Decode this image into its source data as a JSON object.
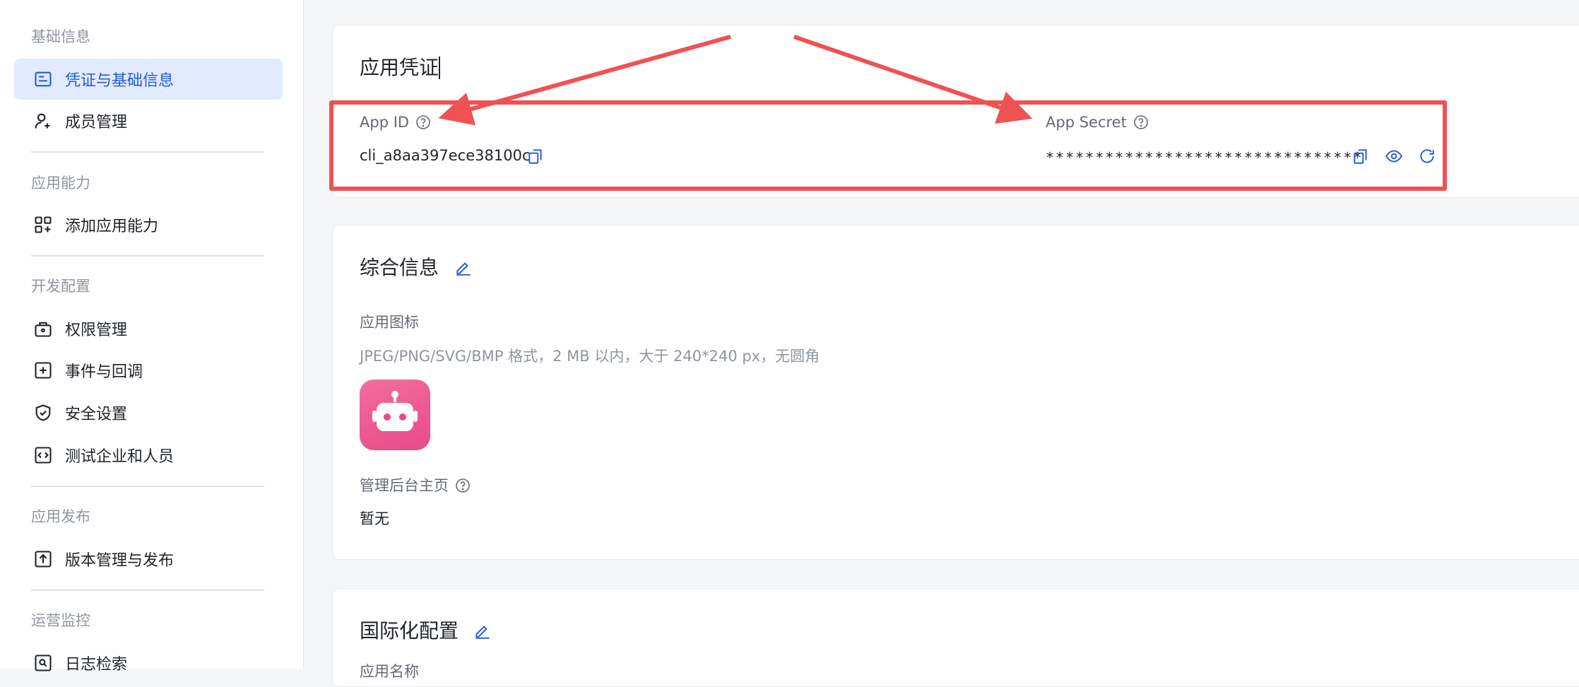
{
  "sidebar": {
    "sections": [
      {
        "title": "基础信息",
        "items": [
          {
            "label": "凭证与基础信息",
            "icon": "credential-card-icon",
            "active": true
          },
          {
            "label": "成员管理",
            "icon": "user-add-icon"
          }
        ]
      },
      {
        "title": "应用能力",
        "items": [
          {
            "label": "添加应用能力",
            "icon": "apps-add-icon"
          }
        ]
      },
      {
        "title": "开发配置",
        "items": [
          {
            "label": "权限管理",
            "icon": "permission-lock-icon"
          },
          {
            "label": "事件与回调",
            "icon": "event-plus-icon"
          },
          {
            "label": "安全设置",
            "icon": "shield-check-icon"
          },
          {
            "label": "测试企业和人员",
            "icon": "code-box-icon"
          }
        ]
      },
      {
        "title": "应用发布",
        "items": [
          {
            "label": "版本管理与发布",
            "icon": "upload-box-icon"
          }
        ]
      },
      {
        "title": "运营监控",
        "items": [
          {
            "label": "日志检索",
            "icon": "log-search-icon"
          }
        ]
      }
    ]
  },
  "credentials": {
    "title": "应用凭证",
    "app_id_label": "App ID",
    "app_id_value": "cli_a8aa397ece38100c",
    "app_secret_label": "App Secret",
    "app_secret_value": "********************************"
  },
  "general": {
    "title": "综合信息",
    "icon_label": "应用图标",
    "icon_hint": "JPEG/PNG/SVG/BMP 格式，2 MB 以内，大于 240*240 px，无圆角",
    "admin_home_label": "管理后台主页",
    "admin_home_value": "暂无"
  },
  "i18n": {
    "title": "国际化配置",
    "app_name_label": "应用名称"
  },
  "colors": {
    "accent": "#245bdb",
    "active_bg": "#e1eaff",
    "annotation_red": "#f05152",
    "robot_pink": "#e94a88"
  }
}
